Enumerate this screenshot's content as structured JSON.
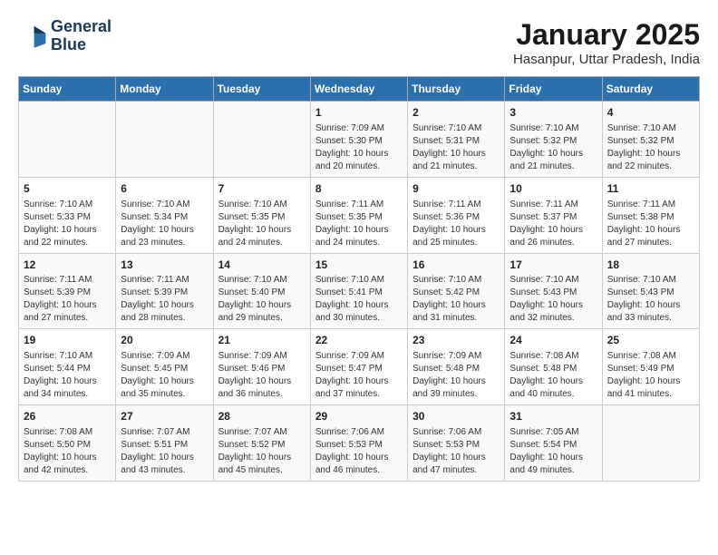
{
  "header": {
    "logo_line1": "General",
    "logo_line2": "Blue",
    "month": "January 2025",
    "location": "Hasanpur, Uttar Pradesh, India"
  },
  "weekdays": [
    "Sunday",
    "Monday",
    "Tuesday",
    "Wednesday",
    "Thursday",
    "Friday",
    "Saturday"
  ],
  "weeks": [
    [
      {
        "day": "",
        "info": ""
      },
      {
        "day": "",
        "info": ""
      },
      {
        "day": "",
        "info": ""
      },
      {
        "day": "1",
        "info": "Sunrise: 7:09 AM\nSunset: 5:30 PM\nDaylight: 10 hours\nand 20 minutes."
      },
      {
        "day": "2",
        "info": "Sunrise: 7:10 AM\nSunset: 5:31 PM\nDaylight: 10 hours\nand 21 minutes."
      },
      {
        "day": "3",
        "info": "Sunrise: 7:10 AM\nSunset: 5:32 PM\nDaylight: 10 hours\nand 21 minutes."
      },
      {
        "day": "4",
        "info": "Sunrise: 7:10 AM\nSunset: 5:32 PM\nDaylight: 10 hours\nand 22 minutes."
      }
    ],
    [
      {
        "day": "5",
        "info": "Sunrise: 7:10 AM\nSunset: 5:33 PM\nDaylight: 10 hours\nand 22 minutes."
      },
      {
        "day": "6",
        "info": "Sunrise: 7:10 AM\nSunset: 5:34 PM\nDaylight: 10 hours\nand 23 minutes."
      },
      {
        "day": "7",
        "info": "Sunrise: 7:10 AM\nSunset: 5:35 PM\nDaylight: 10 hours\nand 24 minutes."
      },
      {
        "day": "8",
        "info": "Sunrise: 7:11 AM\nSunset: 5:35 PM\nDaylight: 10 hours\nand 24 minutes."
      },
      {
        "day": "9",
        "info": "Sunrise: 7:11 AM\nSunset: 5:36 PM\nDaylight: 10 hours\nand 25 minutes."
      },
      {
        "day": "10",
        "info": "Sunrise: 7:11 AM\nSunset: 5:37 PM\nDaylight: 10 hours\nand 26 minutes."
      },
      {
        "day": "11",
        "info": "Sunrise: 7:11 AM\nSunset: 5:38 PM\nDaylight: 10 hours\nand 27 minutes."
      }
    ],
    [
      {
        "day": "12",
        "info": "Sunrise: 7:11 AM\nSunset: 5:39 PM\nDaylight: 10 hours\nand 27 minutes."
      },
      {
        "day": "13",
        "info": "Sunrise: 7:11 AM\nSunset: 5:39 PM\nDaylight: 10 hours\nand 28 minutes."
      },
      {
        "day": "14",
        "info": "Sunrise: 7:10 AM\nSunset: 5:40 PM\nDaylight: 10 hours\nand 29 minutes."
      },
      {
        "day": "15",
        "info": "Sunrise: 7:10 AM\nSunset: 5:41 PM\nDaylight: 10 hours\nand 30 minutes."
      },
      {
        "day": "16",
        "info": "Sunrise: 7:10 AM\nSunset: 5:42 PM\nDaylight: 10 hours\nand 31 minutes."
      },
      {
        "day": "17",
        "info": "Sunrise: 7:10 AM\nSunset: 5:43 PM\nDaylight: 10 hours\nand 32 minutes."
      },
      {
        "day": "18",
        "info": "Sunrise: 7:10 AM\nSunset: 5:43 PM\nDaylight: 10 hours\nand 33 minutes."
      }
    ],
    [
      {
        "day": "19",
        "info": "Sunrise: 7:10 AM\nSunset: 5:44 PM\nDaylight: 10 hours\nand 34 minutes."
      },
      {
        "day": "20",
        "info": "Sunrise: 7:09 AM\nSunset: 5:45 PM\nDaylight: 10 hours\nand 35 minutes."
      },
      {
        "day": "21",
        "info": "Sunrise: 7:09 AM\nSunset: 5:46 PM\nDaylight: 10 hours\nand 36 minutes."
      },
      {
        "day": "22",
        "info": "Sunrise: 7:09 AM\nSunset: 5:47 PM\nDaylight: 10 hours\nand 37 minutes."
      },
      {
        "day": "23",
        "info": "Sunrise: 7:09 AM\nSunset: 5:48 PM\nDaylight: 10 hours\nand 39 minutes."
      },
      {
        "day": "24",
        "info": "Sunrise: 7:08 AM\nSunset: 5:48 PM\nDaylight: 10 hours\nand 40 minutes."
      },
      {
        "day": "25",
        "info": "Sunrise: 7:08 AM\nSunset: 5:49 PM\nDaylight: 10 hours\nand 41 minutes."
      }
    ],
    [
      {
        "day": "26",
        "info": "Sunrise: 7:08 AM\nSunset: 5:50 PM\nDaylight: 10 hours\nand 42 minutes."
      },
      {
        "day": "27",
        "info": "Sunrise: 7:07 AM\nSunset: 5:51 PM\nDaylight: 10 hours\nand 43 minutes."
      },
      {
        "day": "28",
        "info": "Sunrise: 7:07 AM\nSunset: 5:52 PM\nDaylight: 10 hours\nand 45 minutes."
      },
      {
        "day": "29",
        "info": "Sunrise: 7:06 AM\nSunset: 5:53 PM\nDaylight: 10 hours\nand 46 minutes."
      },
      {
        "day": "30",
        "info": "Sunrise: 7:06 AM\nSunset: 5:53 PM\nDaylight: 10 hours\nand 47 minutes."
      },
      {
        "day": "31",
        "info": "Sunrise: 7:05 AM\nSunset: 5:54 PM\nDaylight: 10 hours\nand 49 minutes."
      },
      {
        "day": "",
        "info": ""
      }
    ]
  ]
}
